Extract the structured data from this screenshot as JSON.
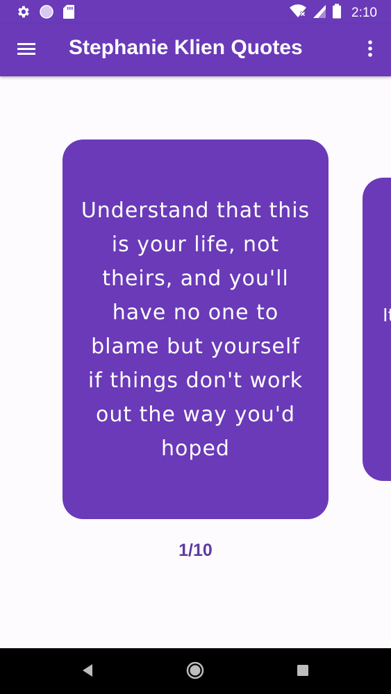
{
  "status_bar": {
    "time": "2:10",
    "icons": [
      "settings-icon",
      "circle-status-icon",
      "sd-card-icon",
      "wifi-icon",
      "signal-icon",
      "battery-icon"
    ]
  },
  "app_bar": {
    "title": "Stephanie Klien Quotes",
    "menu_icon": "hamburger-menu-icon",
    "overflow_icon": "more-vert-icon"
  },
  "quote_card": {
    "text": "Understand that this is your life, not theirs, and you'll have no one to blame but yourself if things don't work out the way you'd hoped"
  },
  "next_card": {
    "partial_text": "It"
  },
  "pager": {
    "counter": "1/10"
  },
  "nav_bar": {
    "buttons": [
      "back-icon",
      "home-icon",
      "recents-icon"
    ]
  },
  "colors": {
    "primary": "#6a3ab8",
    "counter_text": "#5e3aa0",
    "background": "#fefbfe",
    "nav_bar": "#000000"
  }
}
